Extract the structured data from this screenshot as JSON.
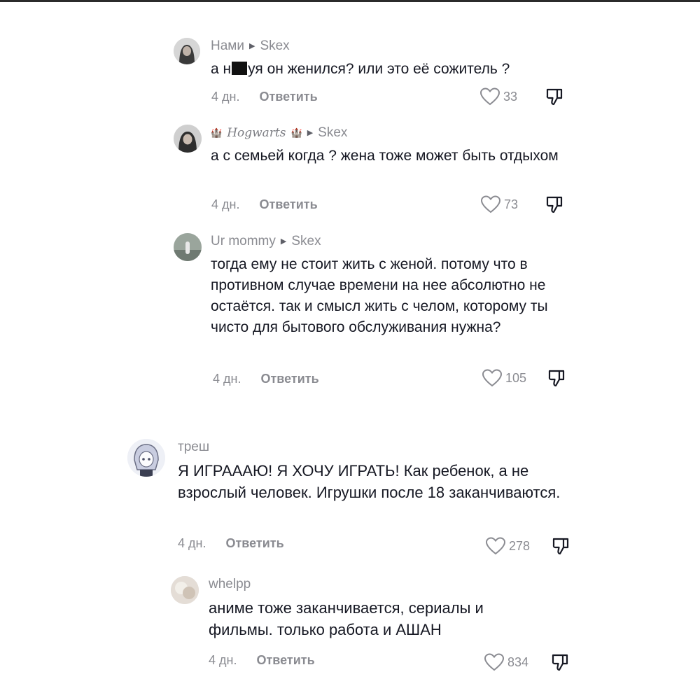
{
  "comments": [
    {
      "author": "Нами",
      "reply_to": "Skex",
      "text_before": "а н",
      "text_after": "уя он женился? или это её сожитель ?",
      "time": "4 дн.",
      "reply_label": "Ответить",
      "likes": "33"
    },
    {
      "author": "Hogwarts",
      "author_deco": "🏰",
      "reply_to": "Skex",
      "text": "а с семьей когда ? жена тоже может быть отдыхом",
      "time": "4 дн.",
      "reply_label": "Ответить",
      "likes": "73"
    },
    {
      "author": "Ur mommy",
      "reply_to": "Skex",
      "text": "тогда ему не стоит жить с женой. потому что в противном случае времени на нее абсолютно не остаётся. так и смысл жить с челом, которому ты чисто для бытового обслуживания нужна?",
      "time": "4 дн.",
      "reply_label": "Ответить",
      "likes": "105"
    },
    {
      "author": "треш",
      "text": "Я ИГРАААЮ! Я ХОЧУ ИГРАТЬ! Как ребенок, а не взрослый человек. Игрушки после 18 заканчиваются.",
      "time": "4 дн.",
      "reply_label": "Ответить",
      "likes": "278"
    },
    {
      "author": "whelpp",
      "text": "аниме тоже заканчивается, сериалы и фильмы. только работа и АШАН",
      "time": "4 дн.",
      "reply_label": "Ответить",
      "likes": "834"
    }
  ],
  "icons": {
    "reply_arrow": "triangle-right-icon",
    "like": "heart-outline-icon",
    "dislike": "thumbs-down-icon"
  },
  "colors": {
    "text": "#161823",
    "muted": "#8a8b91",
    "background": "#ffffff"
  }
}
